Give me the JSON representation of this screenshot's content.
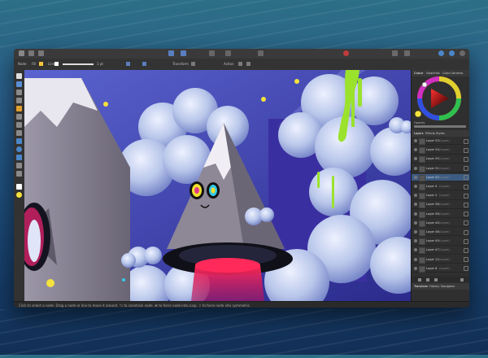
{
  "contextbar": {
    "mode_label": "Node",
    "fill_label": "Fill",
    "stroke_label": "Line",
    "stroke_width": "1 pt",
    "transform_label": "Transform",
    "action_label": "Action"
  },
  "panel": {
    "top_tabs": [
      "Colour",
      "Swatches",
      "Color Libraries"
    ],
    "mid_tabs": [
      "Layers",
      "Effects",
      "Styles"
    ],
    "bottom_tabs": [
      "Transform",
      "History",
      "Navigator"
    ],
    "opacity_label": "Opacity",
    "layers": [
      {
        "name": "Layer 53",
        "blend": "(Layer)"
      },
      {
        "name": "Layer 54",
        "blend": "(Layer)"
      },
      {
        "name": "Layer 55",
        "blend": "(Layer)"
      },
      {
        "name": "Layer 51",
        "blend": "(Layer)"
      },
      {
        "name": "Layer 42",
        "blend": "(Layer)"
      },
      {
        "name": "Layer 4",
        "blend": "(Layer)"
      },
      {
        "name": "Layer 2",
        "blend": "(Layer)"
      },
      {
        "name": "Layer 58",
        "blend": "(Layer)"
      },
      {
        "name": "Layer 56",
        "blend": "(Layer)"
      },
      {
        "name": "Layer 44",
        "blend": "(Layer)"
      },
      {
        "name": "Layer 46",
        "blend": "(Layer)"
      },
      {
        "name": "Layer 49",
        "blend": "(Layer)"
      },
      {
        "name": "Layer 47",
        "blend": "(Layer)"
      },
      {
        "name": "Layer 12",
        "blend": "(Layer)"
      },
      {
        "name": "Layer 8",
        "blend": "(Layer)"
      }
    ],
    "selected_layer": 4
  },
  "statusbar": {
    "text": "Click to select a node. Drag a node or line to move it around. ⌥ to constrain node. ⌘ to force node into cusp. ⇧ to force node into symmetric."
  },
  "colors": {
    "accent": "#3d5b82",
    "canvas_bg": "#4a4fb5",
    "cloud": "#c9d4f0",
    "slime": "#9be22d"
  }
}
